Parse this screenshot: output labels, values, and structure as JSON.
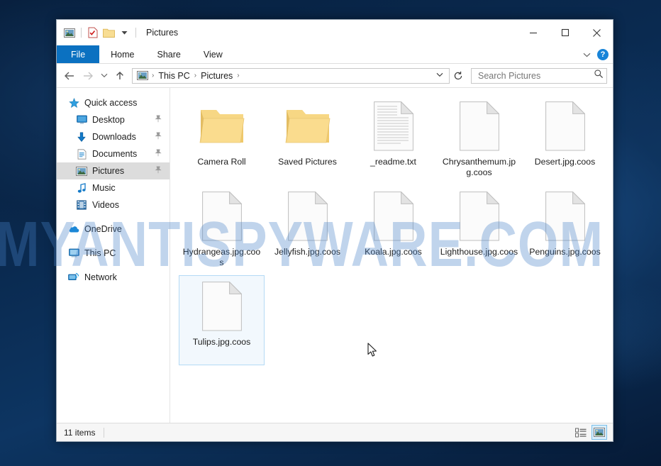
{
  "watermark": {
    "text": "MYANTISPYWARE.COM"
  },
  "window": {
    "title": "Pictures",
    "quick_access_toolbar": [
      {
        "name": "pictures-icon",
        "label": "Pictures properties"
      },
      {
        "name": "properties-icon",
        "label": "Properties"
      },
      {
        "name": "new-folder-icon",
        "label": "New folder"
      },
      {
        "name": "customize-dropdown-icon",
        "label": "Customize Quick Access Toolbar"
      }
    ],
    "caption": {
      "minimize": "─",
      "maximize": "□",
      "close": "✕"
    }
  },
  "ribbon": {
    "tabs": [
      {
        "label": "File",
        "active": true
      },
      {
        "label": "Home",
        "active": false
      },
      {
        "label": "Share",
        "active": false
      },
      {
        "label": "View",
        "active": false
      }
    ],
    "expand_label": "⌄",
    "help_label": "?"
  },
  "address": {
    "back_label": "←",
    "forward_label": "→",
    "recent_label": "⌄",
    "up_label": "↑",
    "breadcrumbs": [
      "This PC",
      "Pictures"
    ],
    "separator": "›",
    "dropdown_label": "⌄",
    "refresh_label": "↻"
  },
  "search": {
    "placeholder": "Search Pictures",
    "value": ""
  },
  "sidebar": {
    "items": [
      {
        "label": "Quick access",
        "icon": "star-icon",
        "level": "root",
        "pinned": false,
        "selected": false
      },
      {
        "label": "Desktop",
        "icon": "desktop-icon",
        "level": "child",
        "pinned": true,
        "selected": false
      },
      {
        "label": "Downloads",
        "icon": "downloads-icon",
        "level": "child",
        "pinned": true,
        "selected": false
      },
      {
        "label": "Documents",
        "icon": "documents-icon",
        "level": "child",
        "pinned": true,
        "selected": false
      },
      {
        "label": "Pictures",
        "icon": "pictures-icon",
        "level": "child",
        "pinned": true,
        "selected": true
      },
      {
        "label": "Music",
        "icon": "music-icon",
        "level": "child",
        "pinned": false,
        "selected": false
      },
      {
        "label": "Videos",
        "icon": "videos-icon",
        "level": "child",
        "pinned": false,
        "selected": false
      },
      {
        "label": "OneDrive",
        "icon": "onedrive-icon",
        "level": "root",
        "pinned": false,
        "selected": false
      },
      {
        "label": "This PC",
        "icon": "thispc-icon",
        "level": "root",
        "pinned": false,
        "selected": false
      },
      {
        "label": "Network",
        "icon": "network-icon",
        "level": "root",
        "pinned": false,
        "selected": false
      }
    ]
  },
  "files": [
    {
      "name": "Camera Roll",
      "type": "folder",
      "selected": false
    },
    {
      "name": "Saved Pictures",
      "type": "folder",
      "selected": false
    },
    {
      "name": "_readme.txt",
      "type": "textfile",
      "selected": false
    },
    {
      "name": "Chrysanthemum.jpg.coos",
      "type": "blankfile",
      "selected": false
    },
    {
      "name": "Desert.jpg.coos",
      "type": "blankfile",
      "selected": false
    },
    {
      "name": "Hydrangeas.jpg.coos",
      "type": "blankfile",
      "selected": false
    },
    {
      "name": "Jellyfish.jpg.coos",
      "type": "blankfile",
      "selected": false
    },
    {
      "name": "Koala.jpg.coos",
      "type": "blankfile",
      "selected": false
    },
    {
      "name": "Lighthouse.jpg.coos",
      "type": "blankfile",
      "selected": false
    },
    {
      "name": "Penguins.jpg.coos",
      "type": "blankfile",
      "selected": false
    },
    {
      "name": "Tulips.jpg.coos",
      "type": "blankfile",
      "selected": true
    }
  ],
  "statusbar": {
    "item_count": "11 items",
    "views": [
      {
        "name": "details-view-button",
        "active": false
      },
      {
        "name": "large-icons-view-button",
        "active": true
      }
    ]
  },
  "colors": {
    "accent": "#0b71c1",
    "folder": "#f5d27a",
    "selection_border": "#b4daf5",
    "selection_fill": "#f2f8fd",
    "watermark": "rgba(70,130,200,0.34)"
  }
}
